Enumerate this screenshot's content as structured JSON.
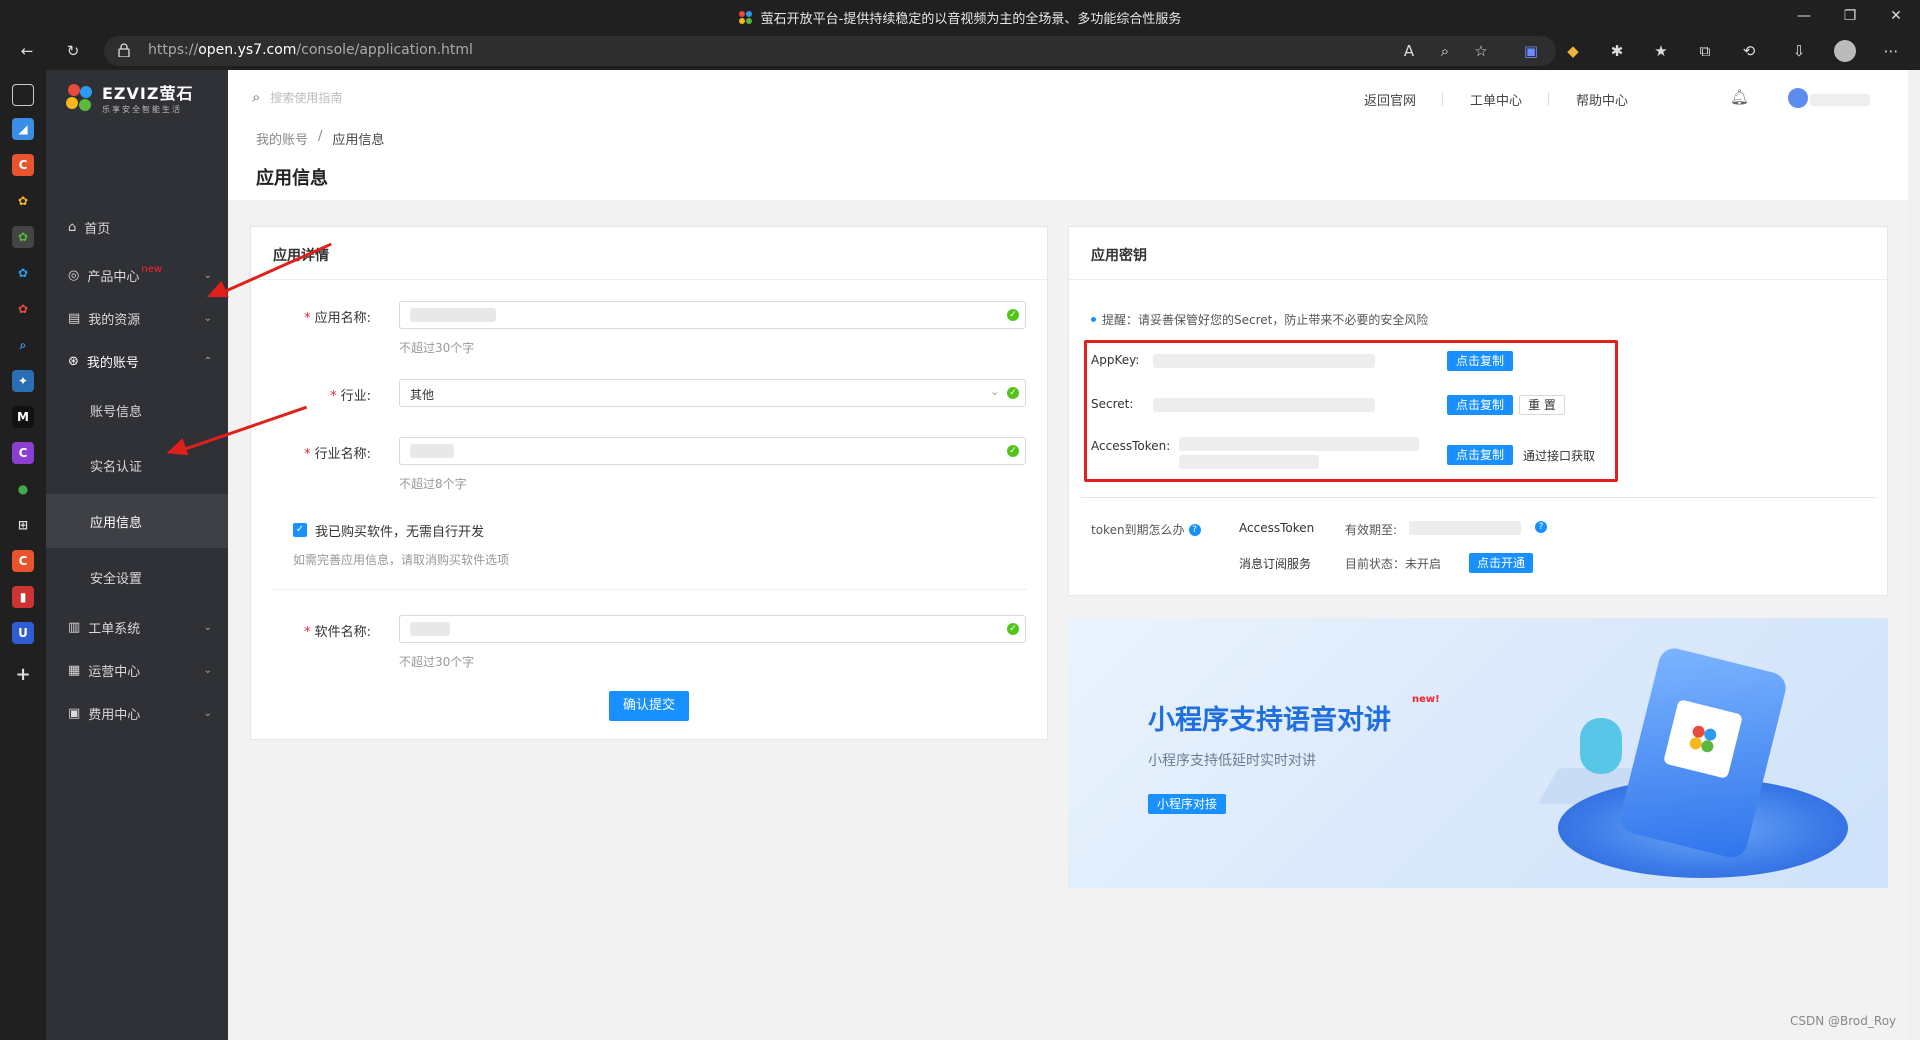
{
  "browser": {
    "title": "萤石开放平台-提供持续稳定的以音视频为主的全场景、多功能综合性服务",
    "url_prefix": "https://",
    "url_host": "open.ys7.com",
    "url_path": "/console/application.html"
  },
  "brand": {
    "logo_text": "EZVIZ萤石",
    "logo_sub": "乐享安全智能生活"
  },
  "nav": {
    "home": "首页",
    "products": "产品中心",
    "products_badge": "new",
    "resources": "我的资源",
    "account": "我的账号",
    "account_sub": [
      "账号信息",
      "实名认证",
      "应用信息",
      "安全设置"
    ],
    "tickets": "工单系统",
    "ops": "运营中心",
    "fees": "费用中心"
  },
  "topbar": {
    "search_placeholder": "搜索使用指南",
    "links": [
      "返回官网",
      "工单中心",
      "帮助中心"
    ]
  },
  "breadcrumb": {
    "parent": "我的账号",
    "sep": "/",
    "current": "应用信息"
  },
  "page_title": "应用信息",
  "details": {
    "title": "应用详情",
    "app_name_label": "应用名称:",
    "app_name_hint": "不超过30个字",
    "industry_label": "行业:",
    "industry_value": "其他",
    "industry_name_label": "行业名称:",
    "industry_name_hint": "不超过8个字",
    "checkbox_label": "我已购买软件，无需自行开发",
    "checkbox_note": "如需完善应用信息，请取消购买软件选项",
    "software_label": "软件名称:",
    "software_hint": "不超过30个字",
    "submit": "确认提交"
  },
  "keys": {
    "title": "应用密钥",
    "notice": "提醒：请妥善保管好您的Secret，防止带来不必要的安全风险",
    "appkey_label": "AppKey:",
    "secret_label": "Secret:",
    "token_label": "AccessToken:",
    "copy": "点击复制",
    "reset": "重 置",
    "via_api": "通过接口获取",
    "token_expire_q": "token到期怎么办",
    "token_name": "AccessToken",
    "valid_until": "有效期至:",
    "msg_service": "消息订阅服务",
    "status": "目前状态：未开启",
    "enable": "点击开通"
  },
  "banner": {
    "title": "小程序支持语音对讲",
    "badge": "new!",
    "subtitle": "小程序支持低延时实时对讲",
    "button": "小程序对接"
  },
  "watermark": "CSDN @Brod_Roy",
  "colors": {
    "accent": "#1890ff",
    "annotation_red": "#e0201a",
    "nav_bg": "#2f3136"
  }
}
